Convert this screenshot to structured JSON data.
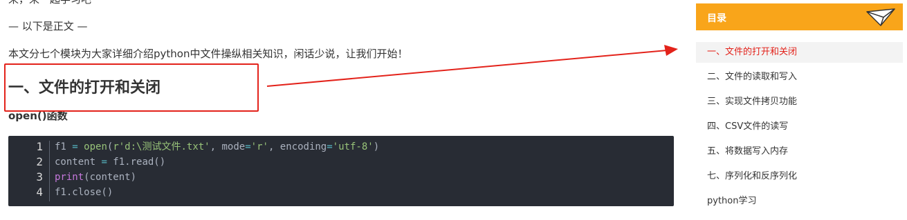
{
  "article": {
    "cut_line": "来，来一起学习吧",
    "divider": "— 以下是正文 —",
    "intro": "本文分七个模块为大家详细介绍python中文件操纵相关知识，闲话少说，让我们开始！",
    "heading": "一、文件的打开和关闭",
    "subheading": "open()函数",
    "code": {
      "line_numbers": [
        "1",
        "2",
        "3",
        "4"
      ],
      "lines": [
        [
          {
            "t": "f1 ",
            "c": "plain"
          },
          {
            "t": "=",
            "c": "op"
          },
          {
            "t": " ",
            "c": "plain"
          },
          {
            "t": "open",
            "c": "fn"
          },
          {
            "t": "(",
            "c": "plain"
          },
          {
            "t": "r'd:\\测试文件.txt'",
            "c": "str"
          },
          {
            "t": ", mode",
            "c": "plain"
          },
          {
            "t": "=",
            "c": "op"
          },
          {
            "t": "'r'",
            "c": "str"
          },
          {
            "t": ", encoding",
            "c": "plain"
          },
          {
            "t": "=",
            "c": "op"
          },
          {
            "t": "'utf-8'",
            "c": "str"
          },
          {
            "t": ")",
            "c": "plain"
          }
        ],
        [
          {
            "t": "content ",
            "c": "plain"
          },
          {
            "t": "=",
            "c": "op"
          },
          {
            "t": " f1.read()",
            "c": "plain"
          }
        ],
        [
          {
            "t": "print",
            "c": "kw"
          },
          {
            "t": "(content)",
            "c": "plain"
          }
        ],
        [
          {
            "t": "f1.close()",
            "c": "plain"
          }
        ]
      ]
    }
  },
  "toc": {
    "title": "目录",
    "icon": "paper-plane-icon",
    "items": [
      {
        "label": "一、文件的打开和关闭",
        "active": true
      },
      {
        "label": "二、文件的读取和写入",
        "active": false
      },
      {
        "label": "三、实现文件拷贝功能",
        "active": false
      },
      {
        "label": "四、CSV文件的读写",
        "active": false
      },
      {
        "label": "五、将数据写入内存",
        "active": false
      },
      {
        "label": "七、序列化和反序列化",
        "active": false
      },
      {
        "label": "python学习",
        "active": false
      }
    ]
  },
  "colors": {
    "accent": "#f9a51a",
    "highlight_red": "#e3221a",
    "code_bg": "#282c34"
  }
}
